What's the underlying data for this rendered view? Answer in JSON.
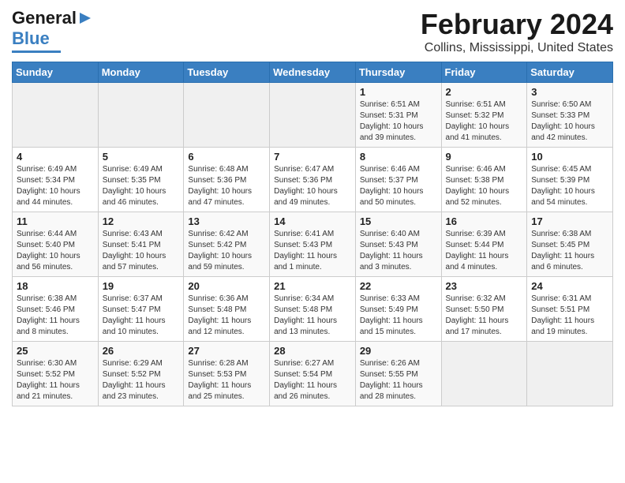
{
  "header": {
    "logo_line1": "General",
    "logo_line2": "Blue",
    "main_title": "February 2024",
    "subtitle": "Collins, Mississippi, United States"
  },
  "days_of_week": [
    "Sunday",
    "Monday",
    "Tuesday",
    "Wednesday",
    "Thursday",
    "Friday",
    "Saturday"
  ],
  "weeks": [
    [
      {
        "day": "",
        "info": ""
      },
      {
        "day": "",
        "info": ""
      },
      {
        "day": "",
        "info": ""
      },
      {
        "day": "",
        "info": ""
      },
      {
        "day": "1",
        "info": "Sunrise: 6:51 AM\nSunset: 5:31 PM\nDaylight: 10 hours\nand 39 minutes."
      },
      {
        "day": "2",
        "info": "Sunrise: 6:51 AM\nSunset: 5:32 PM\nDaylight: 10 hours\nand 41 minutes."
      },
      {
        "day": "3",
        "info": "Sunrise: 6:50 AM\nSunset: 5:33 PM\nDaylight: 10 hours\nand 42 minutes."
      }
    ],
    [
      {
        "day": "4",
        "info": "Sunrise: 6:49 AM\nSunset: 5:34 PM\nDaylight: 10 hours\nand 44 minutes."
      },
      {
        "day": "5",
        "info": "Sunrise: 6:49 AM\nSunset: 5:35 PM\nDaylight: 10 hours\nand 46 minutes."
      },
      {
        "day": "6",
        "info": "Sunrise: 6:48 AM\nSunset: 5:36 PM\nDaylight: 10 hours\nand 47 minutes."
      },
      {
        "day": "7",
        "info": "Sunrise: 6:47 AM\nSunset: 5:36 PM\nDaylight: 10 hours\nand 49 minutes."
      },
      {
        "day": "8",
        "info": "Sunrise: 6:46 AM\nSunset: 5:37 PM\nDaylight: 10 hours\nand 50 minutes."
      },
      {
        "day": "9",
        "info": "Sunrise: 6:46 AM\nSunset: 5:38 PM\nDaylight: 10 hours\nand 52 minutes."
      },
      {
        "day": "10",
        "info": "Sunrise: 6:45 AM\nSunset: 5:39 PM\nDaylight: 10 hours\nand 54 minutes."
      }
    ],
    [
      {
        "day": "11",
        "info": "Sunrise: 6:44 AM\nSunset: 5:40 PM\nDaylight: 10 hours\nand 56 minutes."
      },
      {
        "day": "12",
        "info": "Sunrise: 6:43 AM\nSunset: 5:41 PM\nDaylight: 10 hours\nand 57 minutes."
      },
      {
        "day": "13",
        "info": "Sunrise: 6:42 AM\nSunset: 5:42 PM\nDaylight: 10 hours\nand 59 minutes."
      },
      {
        "day": "14",
        "info": "Sunrise: 6:41 AM\nSunset: 5:43 PM\nDaylight: 11 hours\nand 1 minute."
      },
      {
        "day": "15",
        "info": "Sunrise: 6:40 AM\nSunset: 5:43 PM\nDaylight: 11 hours\nand 3 minutes."
      },
      {
        "day": "16",
        "info": "Sunrise: 6:39 AM\nSunset: 5:44 PM\nDaylight: 11 hours\nand 4 minutes."
      },
      {
        "day": "17",
        "info": "Sunrise: 6:38 AM\nSunset: 5:45 PM\nDaylight: 11 hours\nand 6 minutes."
      }
    ],
    [
      {
        "day": "18",
        "info": "Sunrise: 6:38 AM\nSunset: 5:46 PM\nDaylight: 11 hours\nand 8 minutes."
      },
      {
        "day": "19",
        "info": "Sunrise: 6:37 AM\nSunset: 5:47 PM\nDaylight: 11 hours\nand 10 minutes."
      },
      {
        "day": "20",
        "info": "Sunrise: 6:36 AM\nSunset: 5:48 PM\nDaylight: 11 hours\nand 12 minutes."
      },
      {
        "day": "21",
        "info": "Sunrise: 6:34 AM\nSunset: 5:48 PM\nDaylight: 11 hours\nand 13 minutes."
      },
      {
        "day": "22",
        "info": "Sunrise: 6:33 AM\nSunset: 5:49 PM\nDaylight: 11 hours\nand 15 minutes."
      },
      {
        "day": "23",
        "info": "Sunrise: 6:32 AM\nSunset: 5:50 PM\nDaylight: 11 hours\nand 17 minutes."
      },
      {
        "day": "24",
        "info": "Sunrise: 6:31 AM\nSunset: 5:51 PM\nDaylight: 11 hours\nand 19 minutes."
      }
    ],
    [
      {
        "day": "25",
        "info": "Sunrise: 6:30 AM\nSunset: 5:52 PM\nDaylight: 11 hours\nand 21 minutes."
      },
      {
        "day": "26",
        "info": "Sunrise: 6:29 AM\nSunset: 5:52 PM\nDaylight: 11 hours\nand 23 minutes."
      },
      {
        "day": "27",
        "info": "Sunrise: 6:28 AM\nSunset: 5:53 PM\nDaylight: 11 hours\nand 25 minutes."
      },
      {
        "day": "28",
        "info": "Sunrise: 6:27 AM\nSunset: 5:54 PM\nDaylight: 11 hours\nand 26 minutes."
      },
      {
        "day": "29",
        "info": "Sunrise: 6:26 AM\nSunset: 5:55 PM\nDaylight: 11 hours\nand 28 minutes."
      },
      {
        "day": "",
        "info": ""
      },
      {
        "day": "",
        "info": ""
      }
    ]
  ]
}
